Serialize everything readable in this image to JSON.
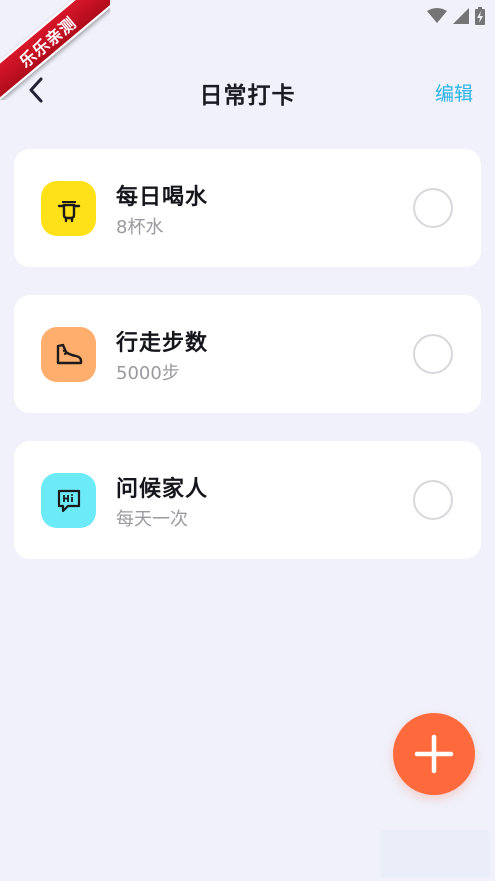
{
  "watermark": {
    "text": "乐乐亲测"
  },
  "header": {
    "title": "日常打卡",
    "edit_label": "编辑",
    "back_icon": "chevron-left-icon"
  },
  "colors": {
    "background": "#f0f1fb",
    "accent": "#2db3e6",
    "fab": "#ff6a3d"
  },
  "tasks": [
    {
      "title": "每日喝水",
      "subtitle": "8杯水",
      "icon": "cup-icon",
      "icon_bg": "#ffe11a",
      "checked": false
    },
    {
      "title": "行走步数",
      "subtitle": "5000步",
      "icon": "shoe-icon",
      "icon_bg": "#ffae6e",
      "checked": false
    },
    {
      "title": "问候家人",
      "subtitle": "每天一次",
      "icon": "chat-hi-icon",
      "icon_bg": "#6ceaf8",
      "checked": false
    }
  ],
  "fab": {
    "icon": "plus-icon"
  }
}
